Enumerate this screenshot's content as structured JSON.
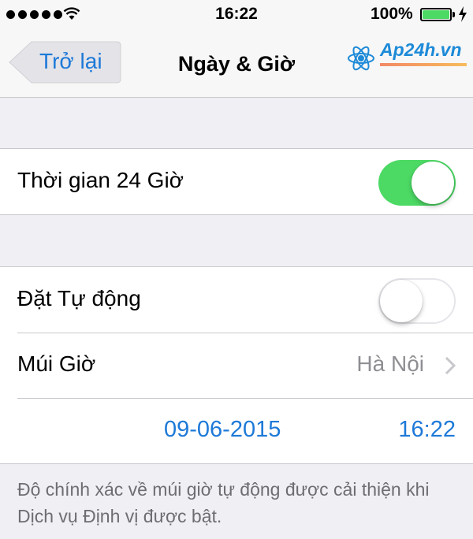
{
  "status_bar": {
    "time": "16:22",
    "battery_percent": "100%",
    "battery_level": 1.0,
    "signal_bars": 5,
    "icons": [
      "signal-dots-icon",
      "wifi-icon",
      "battery-icon",
      "charging-bolt-icon"
    ]
  },
  "nav": {
    "back_label": "Trở lại",
    "title": "Ngày & Giờ",
    "logo_text": "Ap24h.vn"
  },
  "settings": {
    "time_24h": {
      "label": "Thời gian 24 Giờ",
      "on": true
    },
    "set_automatically": {
      "label": "Đặt Tự động",
      "on": false
    },
    "time_zone": {
      "label": "Múi Giờ",
      "value": "Hà Nội"
    },
    "date": "09-06-2015",
    "time": "16:22"
  },
  "footer_note": "Độ chính xác về múi giờ tự động được cải thiện khi Dịch vụ Định vị được bật.",
  "colors": {
    "accent": "#1d79d8",
    "toggle_on": "#4cd964",
    "background": "#efeff4"
  }
}
